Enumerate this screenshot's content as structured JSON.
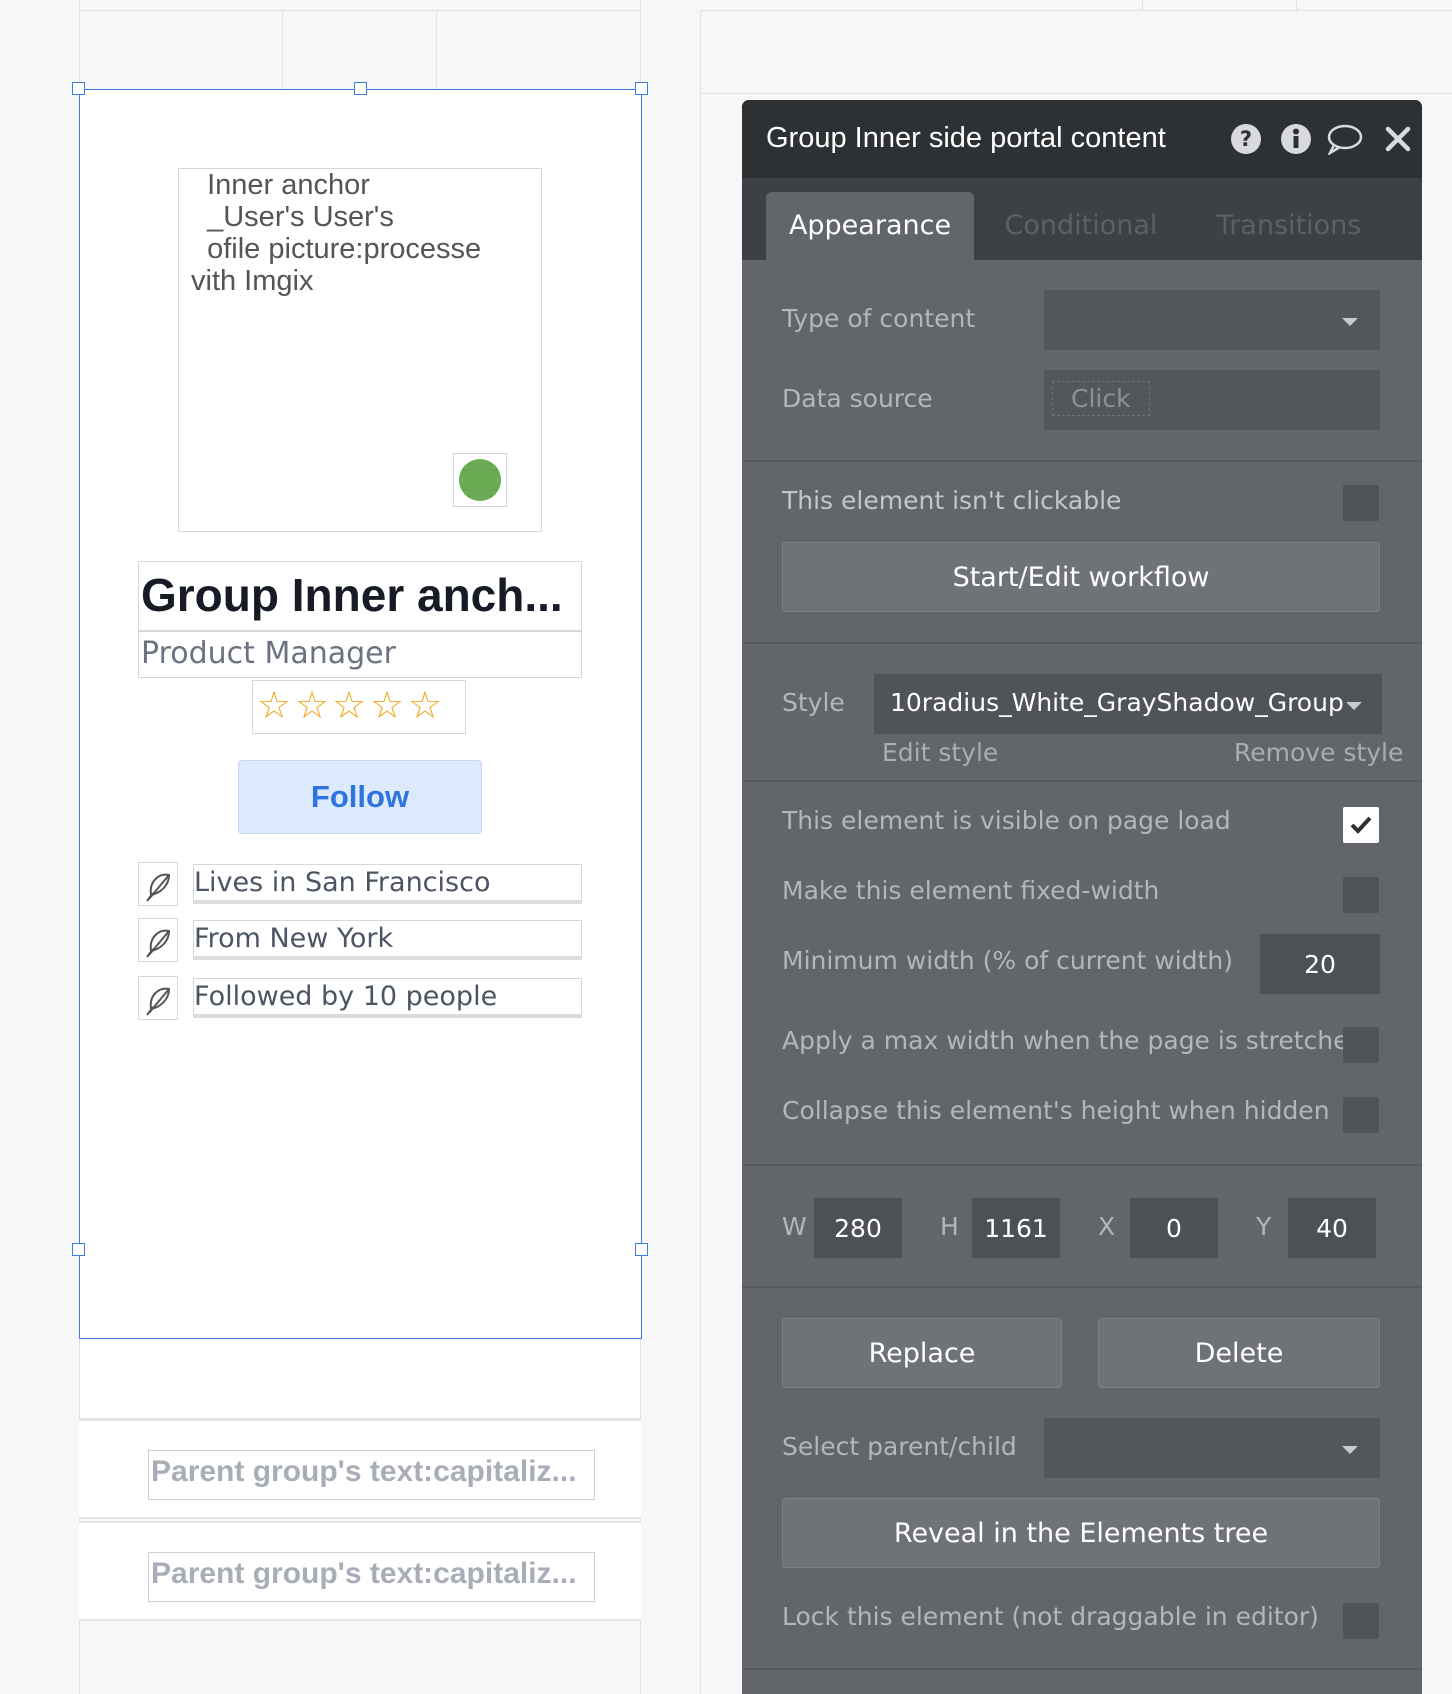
{
  "canvas": {
    "picture_text": "  Inner anchor\n  _User's User's\n  ofile picture:processe\nvith Imgix",
    "name": "Group Inner anch...",
    "role": "Product Manager",
    "stars": [
      "☆",
      "☆",
      "☆",
      "☆",
      "☆"
    ],
    "rating_filled": 0,
    "follow_label": "Follow",
    "info_rows": [
      {
        "label": "Lives in San Francisco"
      },
      {
        "label": "From New York"
      },
      {
        "label": "Followed by 10 people"
      }
    ],
    "parent_texts": [
      "Parent group's text:capitaliz...",
      "Parent group's text:capitaliz..."
    ],
    "status_color": "#6aaa52",
    "selection_color": "#3b7de0"
  },
  "panel": {
    "title": "Group Inner side portal content",
    "icons": [
      "help-icon",
      "info-icon",
      "comment-icon",
      "close-icon"
    ],
    "tabs": [
      "Appearance",
      "Conditional",
      "Transitions"
    ],
    "active_tab": "Appearance",
    "type_of_content_label": "Type of content",
    "type_of_content_value": "",
    "data_source_label": "Data source",
    "data_source_placeholder": "Click",
    "not_clickable_label": "This element isn't clickable",
    "not_clickable_checked": false,
    "workflow_button": "Start/Edit workflow",
    "style_label": "Style",
    "style_value": "10radius_White_GrayShadow_Group",
    "edit_style": "Edit style",
    "remove_style": "Remove style",
    "visible_label": "This element is visible on page load",
    "visible_checked": true,
    "fixed_width_label": "Make this element fixed-width",
    "fixed_width_checked": false,
    "min_width_label": "Minimum width (% of current width)",
    "min_width_value": "20",
    "max_width_label": "Apply a max width when the page is stretched",
    "max_width_checked": false,
    "collapse_label": "Collapse this element's height when hidden",
    "collapse_checked": false,
    "w_label": "W",
    "w_value": "280",
    "h_label": "H",
    "h_value": "1161",
    "x_label": "X",
    "x_value": "0",
    "y_label": "Y",
    "y_value": "40",
    "replace_button": "Replace",
    "delete_button": "Delete",
    "parent_child_label": "Select parent/child",
    "parent_child_value": "",
    "reveal_button": "Reveal in the Elements tree",
    "lock_label": "Lock this element (not draggable in editor)",
    "lock_checked": false
  }
}
